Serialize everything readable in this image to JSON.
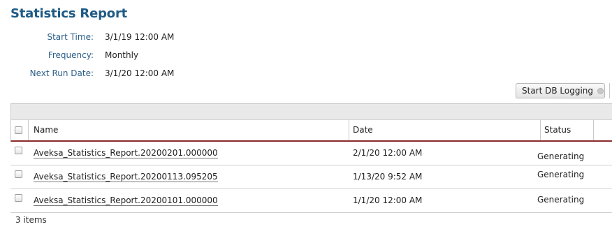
{
  "page": {
    "title": "Statistics Report"
  },
  "fields": [
    {
      "label": "Start Time:",
      "value": "3/1/19 12:00 AM"
    },
    {
      "label": "Frequency:",
      "value": "Monthly"
    },
    {
      "label": "Next Run Date:",
      "value": "3/1/20 12:00 AM"
    }
  ],
  "toolbar": {
    "start_db_logging_label": "Start DB Logging"
  },
  "table": {
    "columns": [
      "Name",
      "Date",
      "Status"
    ],
    "rows": [
      {
        "name": "Aveksa_Statistics_Report.20200201.000000",
        "date": "2/1/20 12:00 AM",
        "status": "Generating"
      },
      {
        "name": "Aveksa_Statistics_Report.20200113.095205",
        "date": "1/13/20 9:52 AM",
        "status": "Generating"
      },
      {
        "name": "Aveksa_Statistics_Report.20200101.000000",
        "date": "1/1/20 12:00 AM",
        "status": "Generating"
      }
    ]
  },
  "footer": {
    "item_count": "3 items"
  }
}
